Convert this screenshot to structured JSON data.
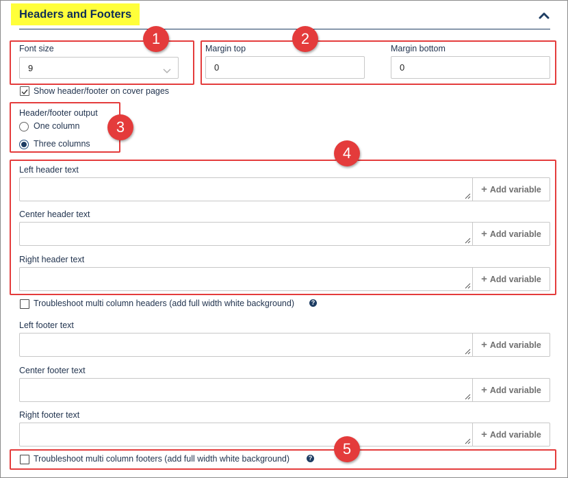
{
  "section": {
    "title": "Headers and Footers",
    "accent": "#ffff3a",
    "rule_color": "#1e3d63"
  },
  "font_size": {
    "label": "Font size",
    "value": "9"
  },
  "margin_top": {
    "label": "Margin top",
    "value": "0"
  },
  "margin_bottom": {
    "label": "Margin bottom",
    "value": "0"
  },
  "cover_pages": {
    "label": "Show header/footer on cover pages",
    "checked": true
  },
  "output": {
    "label": "Header/footer output",
    "options": [
      {
        "label": "One column",
        "selected": false
      },
      {
        "label": "Three columns",
        "selected": true
      }
    ]
  },
  "header_fields": [
    {
      "label": "Left header text",
      "value": "",
      "button": "Add variable"
    },
    {
      "label": "Center header text",
      "value": "",
      "button": "Add variable"
    },
    {
      "label": "Right header text",
      "value": "",
      "button": "Add variable"
    }
  ],
  "troubleshoot_headers": {
    "label": "Troubleshoot multi column headers (add full width white background)",
    "checked": false
  },
  "footer_fields": [
    {
      "label": "Left footer text",
      "value": "",
      "button": "Add variable"
    },
    {
      "label": "Center footer text",
      "value": "",
      "button": "Add variable"
    },
    {
      "label": "Right footer text",
      "value": "",
      "button": "Add variable"
    }
  ],
  "troubleshoot_footers": {
    "label": "Troubleshoot multi column footers (add full width white background)",
    "checked": false
  },
  "callouts": [
    "1",
    "2",
    "3",
    "4",
    "5"
  ],
  "callout_color": "#e43b3b",
  "icons": {
    "collapse": "chevron-up-icon",
    "select": "chevron-down-icon",
    "add": "plus-icon",
    "help": "question-circle-icon",
    "resize": "resize-grip-icon",
    "check": "checkmark-icon"
  }
}
